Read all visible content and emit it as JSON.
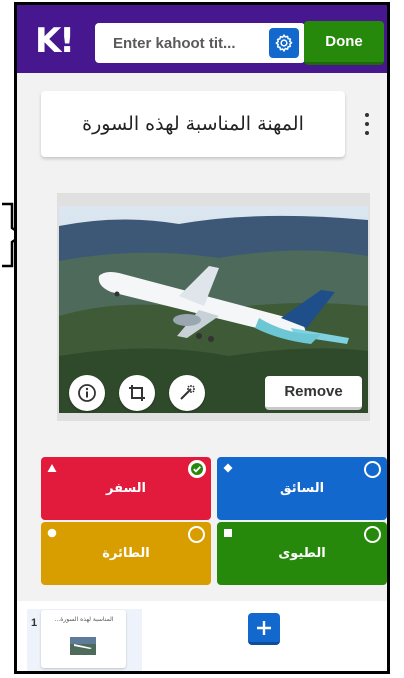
{
  "header": {
    "logo_text": "K!",
    "title_placeholder": "Enter kahoot tit...",
    "done_label": "Done",
    "colors": {
      "bar": "#46178f",
      "done": "#26890c",
      "settings": "#1368ce"
    }
  },
  "question": {
    "text": "المهنة المناسبة لهذه السورة"
  },
  "media": {
    "remove_label": "Remove",
    "icons": [
      "info-icon",
      "crop-icon",
      "magic-wand-icon"
    ]
  },
  "answers": [
    {
      "text": "السفر",
      "shape": "triangle",
      "color": "#e21b3c",
      "correct": true
    },
    {
      "text": "السائق",
      "shape": "diamond",
      "color": "#1368ce",
      "correct": false
    },
    {
      "text": "الطائرة",
      "shape": "circle",
      "color": "#d89e00",
      "correct": false
    },
    {
      "text": "الطيوى",
      "shape": "square",
      "color": "#26890c",
      "correct": false
    }
  ],
  "slides": {
    "items": [
      {
        "number": "1",
        "title": "...المناسبة لهذه السورة"
      }
    ]
  }
}
